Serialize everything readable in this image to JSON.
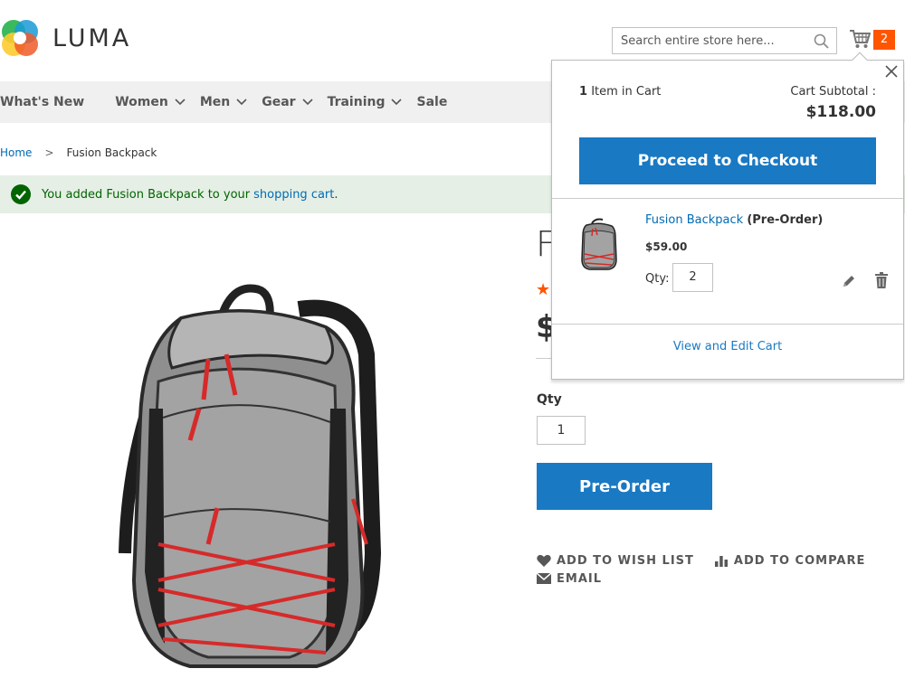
{
  "brand": {
    "name": "LUMA"
  },
  "search": {
    "placeholder": "Search entire store here..."
  },
  "cart": {
    "count": "2"
  },
  "nav": {
    "items": [
      {
        "label": "What's New",
        "has_dropdown": false
      },
      {
        "label": "Women",
        "has_dropdown": true
      },
      {
        "label": "Men",
        "has_dropdown": true
      },
      {
        "label": "Gear",
        "has_dropdown": true
      },
      {
        "label": "Training",
        "has_dropdown": true
      },
      {
        "label": "Sale",
        "has_dropdown": false
      }
    ]
  },
  "breadcrumb": {
    "home": "Home",
    "separator": ">",
    "current": "Fusion Backpack"
  },
  "message": {
    "text": "You added Fusion Backpack to your",
    "link": "shopping cart",
    "suffix": "."
  },
  "product": {
    "title_visible": "F",
    "rating_visible": "★",
    "price_visible": "$",
    "qty_label": "Qty",
    "qty_value": "1",
    "preorder_label": "Pre-Order",
    "actions": {
      "wishlist": "ADD TO WISH LIST",
      "compare": "ADD TO COMPARE",
      "email": "EMAIL"
    }
  },
  "minicart": {
    "count_number": "1",
    "count_text": "Item in Cart",
    "subtotal_label": "Cart Subtotal :",
    "subtotal": "$118.00",
    "checkout_label": "Proceed to Checkout",
    "item": {
      "name": "Fusion Backpack",
      "tag": "(Pre-Order)",
      "price": "$59.00",
      "qty_label": "Qty:",
      "qty": "2"
    },
    "view_edit_label": "View and Edit Cart"
  },
  "colors": {
    "primary_button": "#1979c3",
    "link": "#006bb4",
    "badge": "#ff5501",
    "success_bg": "#e5efe5",
    "success_text": "#006400",
    "nav_bg": "#f0f0f0"
  }
}
